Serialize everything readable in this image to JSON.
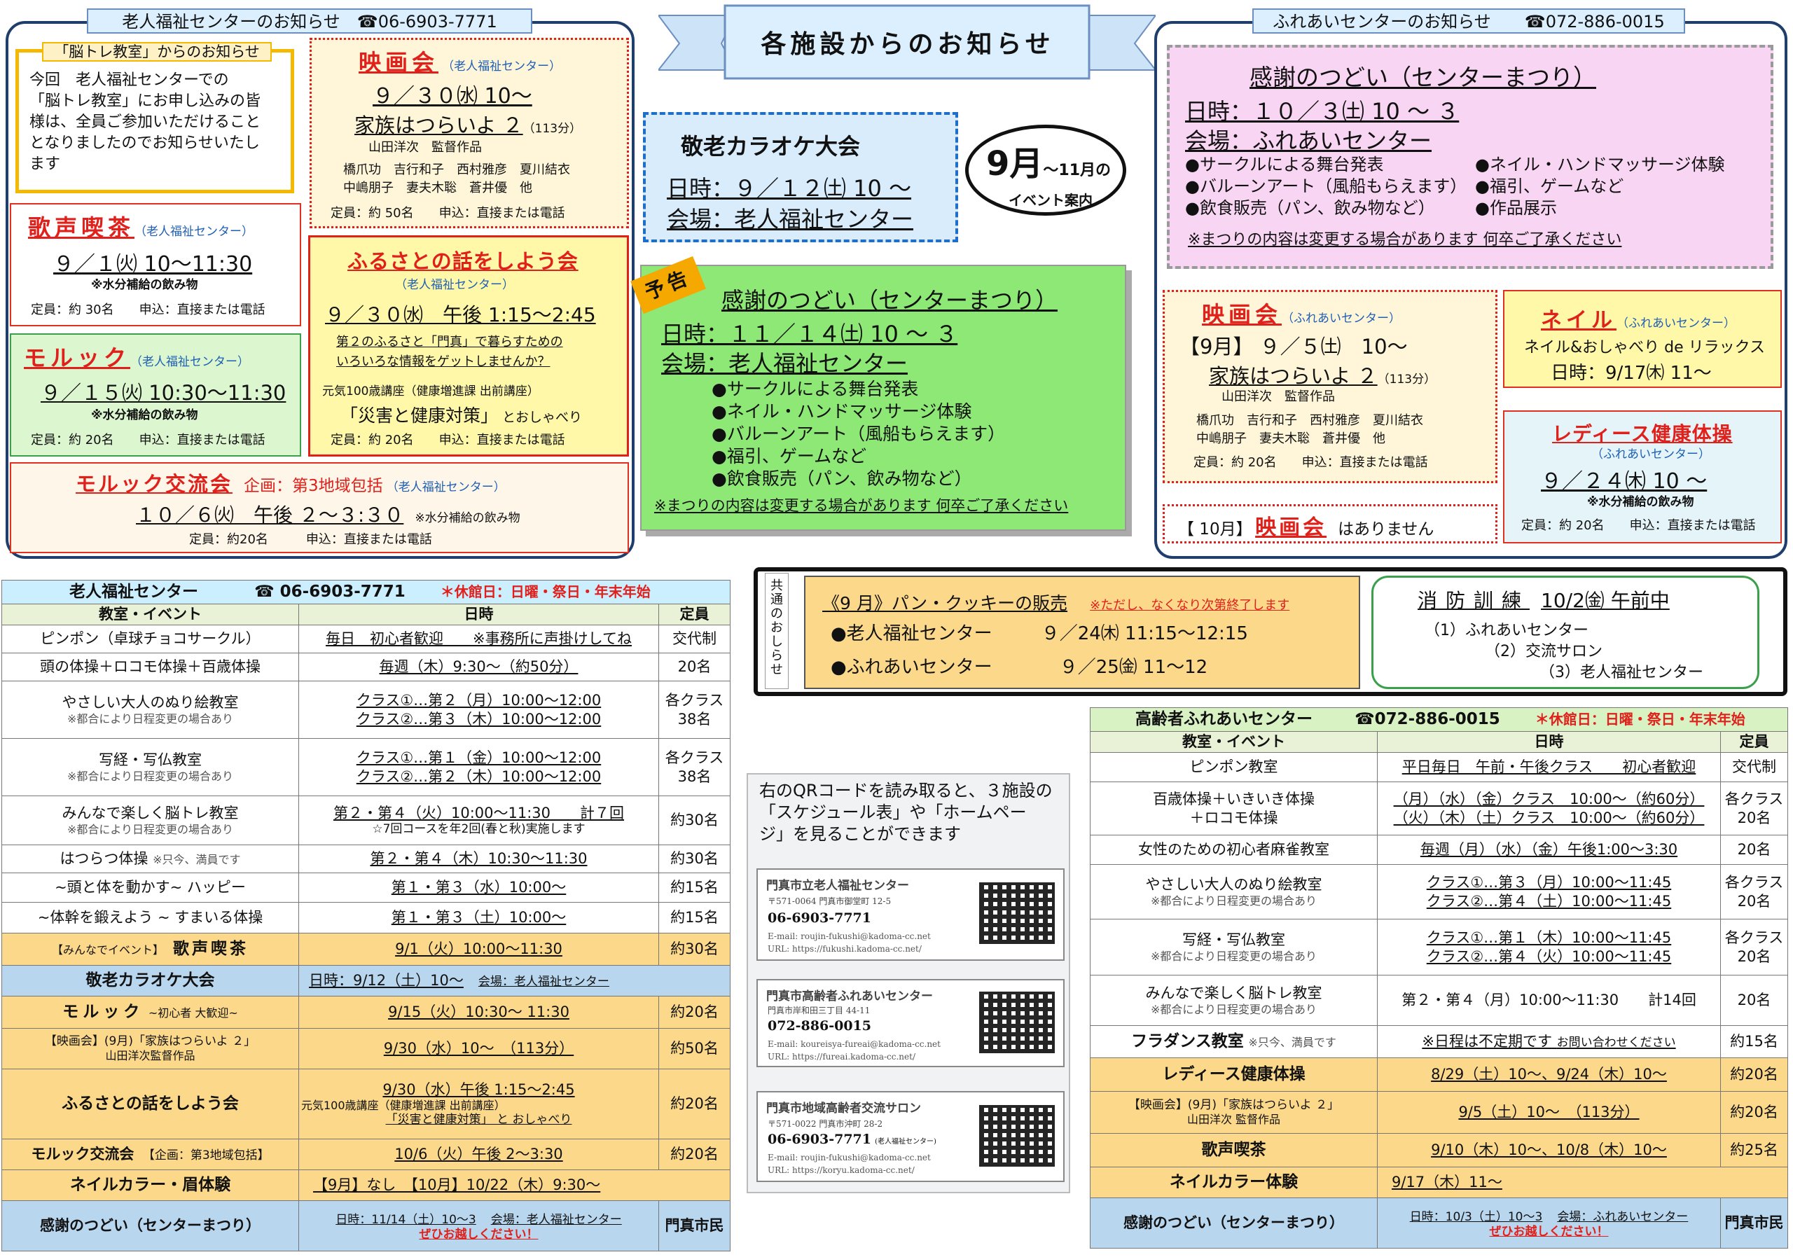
{
  "banner": {
    "title": "各施設からのお知らせ"
  },
  "left": {
    "tab": "老人福祉センターのお知らせ　☎06-6903-7771",
    "brain": {
      "title": "「脳トレ教室」からのお知らせ",
      "lines": [
        "今回　老人福祉センターでの",
        "「脳トレ教室」にお申し込みの皆",
        "様は、全員ご参加いただけること",
        "となりましたのでお知らせいたし",
        "ます"
      ]
    },
    "movie": {
      "title": "映画会",
      "org": "（老人福祉センター）",
      "date": "９／３０㈬ 10〜",
      "film": "家族はつらいよ ２",
      "mins": "（113分）",
      "director": "山田洋次　監督作品",
      "cast1": "橋爪功　吉行和子　西村雅彦　夏川結衣",
      "cast2": "中嶋朋子　妻夫木聡　蒼井優　他",
      "cap": "定員：約 50名　　申込：直接または電話"
    },
    "kissa": {
      "title": "歌声喫茶",
      "org": "（老人福祉センター）",
      "date": "９／１㈫ 10〜11:30",
      "note": "※水分補給の飲み物",
      "cap": "定員：約 30名　　申込：直接または電話"
    },
    "furusato": {
      "title": "ふるさとの話をしよう会",
      "org": "（老人福祉センター）",
      "date": "９／３０㈬　午後 1:15〜2:45",
      "s1": "第２のふるさと「門真」で暮らすための",
      "s2": "いろいろな情報をゲットしませんか？",
      "lect": "元気100歳講座（健康増進課 出前講座）",
      "theme": "「災害と健康対策」",
      "and": " とおしゃべり",
      "cap": "定員：約 20名　　申込：直接または電話"
    },
    "moruk": {
      "title": "モルック",
      "org": "（老人福祉センター）",
      "date": "９／１５㈫ 10:30〜11:30",
      "note": "※水分補給の飲み物",
      "cap": "定員：約 20名　　申込：直接または電話"
    },
    "morukx": {
      "title": "モルック交流会",
      "plan": "企画：第3地域包括",
      "org": "（老人福祉センター）",
      "date": "１０／６㈫　午後 ２〜３:３０",
      "note": "※水分補給の飲み物",
      "cap": "定員：約20名　　　申込：直接または電話"
    }
  },
  "center": {
    "karaoke": {
      "title": "敬老カラオケ大会",
      "date": "日時：９／１２㈯ 10 〜",
      "place": "会場：老人福祉センター"
    },
    "month": {
      "big": "9月",
      "small": "〜11月の",
      "sub": "イベント案内"
    },
    "yokoku": "予告",
    "thanks": {
      "title": "感謝のつどい（センターまつり）",
      "date": "日時：１１／１４㈯ 10 〜 ３",
      "place": "会場：老人福祉センター",
      "items": [
        "●サークルによる舞台発表",
        "●ネイル・ハンドマッサージ体験",
        "●バルーンアート（風船もらえます）",
        "●福引、ゲームなど",
        "●飲食販売（パン、飲み物など）"
      ],
      "note": "※まつりの内容は変更する場合があります 何卒ご了承ください"
    }
  },
  "right": {
    "tab": "ふれあいセンターのお知らせ　　☎072-886-0015",
    "thanks": {
      "title": "感謝のつどい（センターまつり）",
      "date": "日時：１０／３㈯ 10 〜 ３",
      "place": "会場：ふれあいセンター",
      "a1": "●サークルによる舞台発表",
      "b1": "●ネイル・ハンドマッサージ体験",
      "a2": "●バルーンアート（風船もらえます）",
      "b2": "●福引、ゲームなど",
      "a3": "●飲食販売（パン、飲み物など）",
      "b3": "●作品展示",
      "note": "※まつりの内容は変更する場合があります 何卒ご了承ください"
    },
    "movie": {
      "title": "映画会",
      "org": "（ふれあいセンター）",
      "date": "【9月】 ９／５㈯　10〜",
      "film": "家族はつらいよ ２",
      "mins": "（113分）",
      "director": "山田洋次　監督作品",
      "cast1": "橋爪功　吉行和子　西村雅彦　夏川結衣",
      "cast2": "中嶋朋子　妻夫木聡　蒼井優　他",
      "cap": "定員：約 20名　　申込：直接または電話"
    },
    "nail": {
      "title": "ネイル",
      "org": "（ふれあいセンター）",
      "l1": "ネイル&おしゃべり de リラックス",
      "l2": "日時：9/17㈭ 11〜"
    },
    "ladies": {
      "title": "レディース健康体操",
      "org": "（ふれあいセンター）",
      "date": "９／２４㈭ 10 〜",
      "note": "※水分補給の飲み物",
      "cap": "定員：約 20名　　申込：直接または電話"
    },
    "oct": {
      "pre": "【 10月】",
      "title": "映画会",
      "post": "はありません"
    }
  },
  "common": {
    "side": "共通のおしらせ",
    "l1": "《9 月》パン・クッキーの販売",
    "l1n": "※ただし、なくなり次第終了します",
    "l2a": "●老人福祉センター",
    "l2b": "９／24㈭ 11:15〜12:15",
    "l3a": "●ふれあいセンター",
    "l3b": "９／25㈮ 11〜12"
  },
  "fire": {
    "title": "消防訓練",
    "date": "10/2㈮ 午前中",
    "l1": "（1）ふれあいセンター",
    "l2": "（2）交流サロン",
    "l3": "（3）老人福祉センター"
  },
  "qr": {
    "intro1": "右のQRコードを読み取ると、３施設の",
    "intro2": "「スケジュール表」や「ホームペー",
    "intro3": "ジ」を見ることができます",
    "cards": [
      {
        "name": "門真市立老人福祉センター",
        "addr": "〒571-0064 門真市御堂町 12-5",
        "tel": "06-6903-7771",
        "mail": "E-mail: roujin-fukushi@kadoma-cc.net",
        "url": "URL: https://fukushi.kadoma-cc.net/"
      },
      {
        "name": "門真市高齢者ふれあいセンター",
        "addr": "門真市岸和田三丁目 44-11",
        "tel": "072-886-0015",
        "mail": "E-mail: koureisya-fureai@kadoma-cc.net",
        "url": "URL: https://fureai.kadoma-cc.net/"
      },
      {
        "name": "門真市地域高齢者交流サロン",
        "addr": "〒571-0022 門真市沖町 28-2",
        "tel": "06-6903-7771",
        "telnote": "(老人福祉センター)",
        "mail": "E-mail: roujin-fukushi@kadoma-cc.net",
        "url": "URL: https://koryu.kadoma-cc.net/"
      }
    ]
  },
  "t1": {
    "title": "老人福祉センター",
    "tel": "☎ 06-6903-7771",
    "closed": "＊休館日：日曜・祭日・年末年始",
    "h": [
      "教室・イベント",
      "日時",
      "定員"
    ],
    "rows": [
      [
        "ピンポン（卓球チョコサークル）",
        "毎日　初心者歓迎　　※事務所に声掛けしてね",
        "交代制"
      ],
      [
        "頭の体操＋ロコモ体操＋百歳体操",
        "毎週（木）9:30〜（約50分）",
        "20名"
      ],
      [
        "やさしい大人のぬり絵教室",
        "クラス①…第２（月）10:00〜12:00",
        "各クラス",
        "※都合により日程変更の場合あり",
        "クラス②…第３（木）10:00〜12:00",
        "38名"
      ],
      [
        "写経・写仏教室",
        "クラス①…第１（金）10:00〜12:00",
        "各クラス",
        "※都合により日程変更の場合あり",
        "クラス②…第２（木）10:00〜12:00",
        "38名"
      ],
      [
        "みんなで楽しく脳トレ教室",
        "第２・第４（火）10:00〜11:30　　計７回",
        "約30名",
        "※都合により日程変更の場合あり",
        "☆7回コースを年2回(春と秋)実施します"
      ],
      [
        "はつらつ体操",
        "※只今、満員です",
        "第２・第４（木）10:30〜11:30",
        "約30名"
      ],
      [
        "~頭と体を動かす~ ハッピー",
        "第１・第３（水）10:00〜",
        "約15名"
      ],
      [
        "~体幹を鍛えよう ~ すまいる体操",
        "第１・第３（土）10:00〜",
        "約15名"
      ],
      [
        "【みんなでイベント】",
        "歌声喫茶",
        "9/1（火）10:00〜11:30",
        "約30名"
      ],
      [
        "敬老カラオケ大会",
        "日時：9/12（土）10〜",
        "会場：老人福祉センター"
      ],
      [
        "モルック",
        "~初心者 大歓迎~",
        "9/15（火）10:30〜 11:30",
        "約20名"
      ],
      [
        "【映画会】(9月)「家族はつらいよ ２」",
        "山田洋次監督作品",
        "9/30（水）10〜　（113分）",
        "約50名"
      ],
      [
        "ふるさとの話をしよう会",
        "9/30（水）午後 1:15〜2:45",
        "元気100歳講座（健康増進課 出前講座）",
        "「災害と健康対策」 と おしゃべり",
        "約20名"
      ],
      [
        "モルック交流会",
        "【企画：第3地域包括】",
        "10/6（火）午後 2〜3:30",
        "約20名"
      ],
      [
        "ネイルカラー・眉体験",
        "【9月】なし　【10月】10/22（木）9:30〜"
      ],
      [
        "感謝のつどい（センターまつり）",
        "日時：11/14（土）10〜3",
        "会場：老人福祉センター",
        "ぜひお越しください！",
        "門真市民"
      ]
    ]
  },
  "t2": {
    "title": "高齢者ふれあいセンター",
    "tel": "☎072-886-0015",
    "closed": "＊休館日：日曜・祭日・年末年始",
    "h": [
      "教室・イベント",
      "日時",
      "定員"
    ],
    "rows": [
      [
        "ピンポン教室",
        "平日毎日　午前・午後クラス　　初心者歓迎",
        "交代制"
      ],
      [
        "百歳体操＋いきいき体操",
        "（月）（水）（金）クラス　10:00〜（約60分）",
        "各クラス",
        "＋ロコモ体操",
        "（火）（木）（土）クラス　10:00〜（約60分）",
        "20名"
      ],
      [
        "女性のための初心者麻雀教室",
        "毎週（月）（水）（金）午後1:00〜3:30",
        "20名"
      ],
      [
        "やさしい大人のぬり絵教室",
        "クラス①…第３（月）10:00〜11:45",
        "各クラス",
        "※都合により日程変更の場合あり",
        "クラス②…第４（土）10:00〜11:45",
        "20名"
      ],
      [
        "写経・写仏教室",
        "クラス①…第１（木）10:00〜11:45",
        "各クラス",
        "※都合により日程変更の場合あり",
        "クラス②…第４（火）10:00〜11:45",
        "20名"
      ],
      [
        "みんなで楽しく脳トレ教室",
        "第２・第４（月）10:00〜11:30　　計14回",
        "20名",
        "※都合により日程変更の場合あり"
      ],
      [
        "フラダンス教室",
        "※只今、満員です",
        "※日程は不定期です",
        "お問い合わせください",
        "約15名"
      ],
      [
        "レディース健康体操",
        "8/29（土）10〜、9/24（木）10〜",
        "約20名"
      ],
      [
        "【映画会】(9月)「家族はつらいよ ２」",
        "山田洋次 監督作品",
        "9/5（土）10〜　（113分）",
        "約20名"
      ],
      [
        "歌声喫茶",
        "9/10（木）10〜、10/8（木）10〜",
        "約25名"
      ],
      [
        "ネイルカラー体験",
        "9/17（木）11〜"
      ],
      [
        "感謝のつどい（センターまつり）",
        "日時：10/3（土）10〜3",
        "会場：ふれあいセンター",
        "ぜひお越しください！",
        "門真市民"
      ]
    ]
  }
}
